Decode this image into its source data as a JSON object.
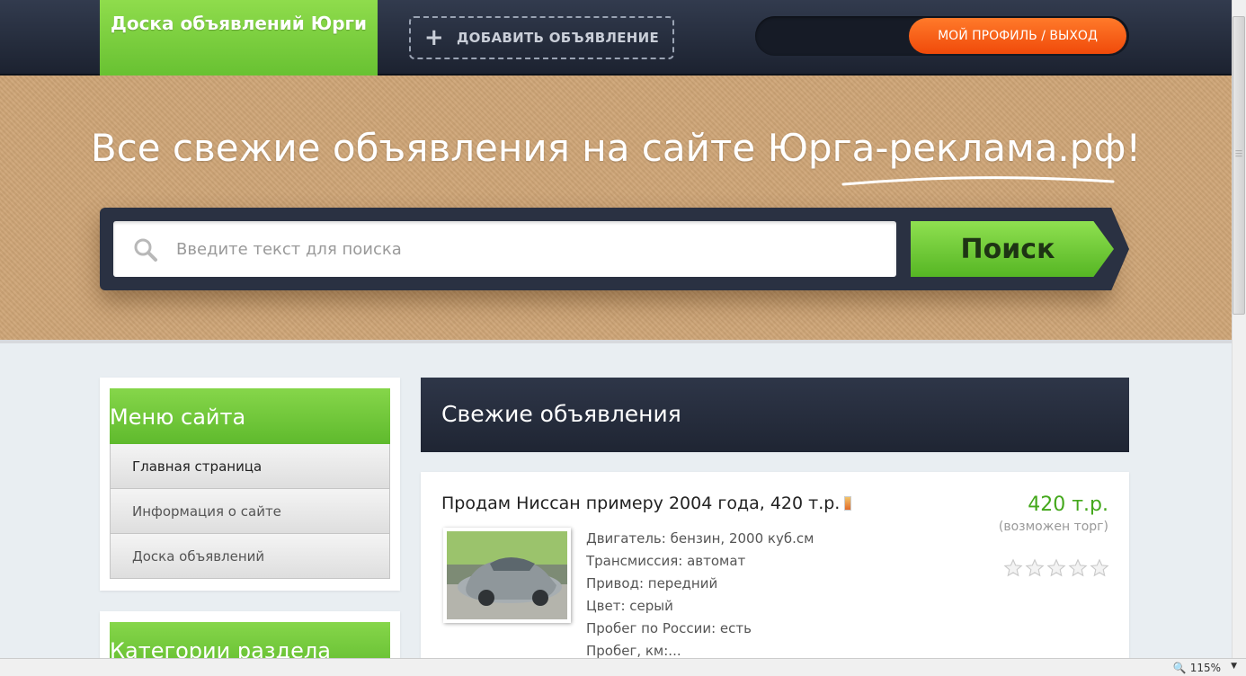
{
  "header": {
    "logo_text": "Доска объявлений Юрги",
    "add_button": "ДОБАВИТЬ ОБЪЯВЛЕНИЕ",
    "profile_button": "МОЙ ПРОФИЛЬ / ВЫХОД"
  },
  "hero": {
    "title": "Все свежие объявления на сайте Юрга-реклама.рф!"
  },
  "search": {
    "placeholder": "Введите текст для поиска",
    "button": "Поиск"
  },
  "sidebar": {
    "menu_title": "Меню сайта",
    "menu_items": [
      {
        "label": "Главная страница"
      },
      {
        "label": "Информация о сайте"
      },
      {
        "label": "Доска объявлений"
      }
    ],
    "categories_title": "Категории раздела"
  },
  "main": {
    "section_title": "Свежие объявления",
    "ad": {
      "title": "Продам Ниссан примеру 2004 года, 420 т.р.",
      "price": "420 т.р.",
      "bargain": "(возможен торг)",
      "rating_filled": 0,
      "rating_max": 5,
      "specs": [
        "Двигатель: бензин, 2000 куб.см",
        "Трансмиссия: автомат",
        "Привод: передний",
        "Цвет: серый",
        "Пробег по России: есть",
        "Пробег, км:..."
      ]
    }
  },
  "statusbar": {
    "zoom": "115%"
  },
  "colors": {
    "accent_green": "#6cc636",
    "accent_orange": "#f25a14",
    "dark_navy": "#252c3b",
    "price_green": "#44a81c"
  }
}
